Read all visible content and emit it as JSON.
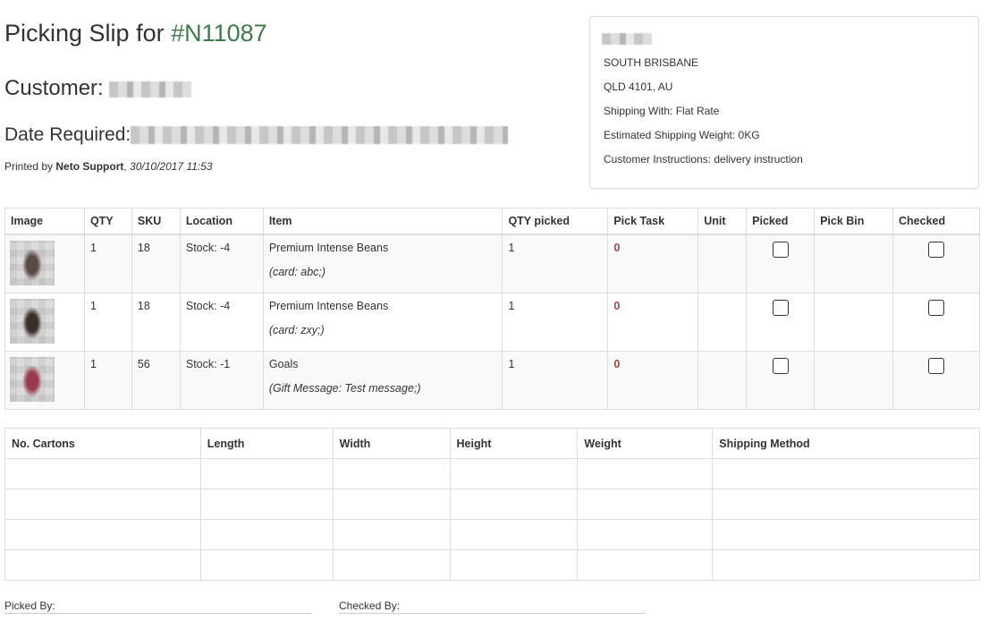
{
  "header": {
    "title_prefix": "Picking Slip for ",
    "order_number": "#N11087",
    "customer_label": "Customer: ",
    "date_label": "Date Required:",
    "printed_by_label": "Printed by ",
    "printed_by_name": "Neto Support",
    "printed_at": "30/10/2017 11:53"
  },
  "address": {
    "lines": [
      "SOUTH BRISBANE",
      "QLD 4101, AU",
      "Shipping With: Flat Rate",
      "Estimated Shipping Weight: 0KG",
      "Customer Instructions: delivery instruction"
    ]
  },
  "items_table": {
    "headers": [
      "Image",
      "QTY",
      "SKU",
      "Location",
      "Item",
      "QTY picked",
      "Pick Task",
      "Unit",
      "Picked",
      "Pick Bin",
      "Checked"
    ],
    "rows": [
      {
        "qty": "1",
        "sku": "18",
        "location": "Stock: -4",
        "item": "Premium Intense Beans",
        "options": "(card: abc;)",
        "qty_picked": "1",
        "pick_task": "0",
        "unit": "",
        "pick_bin": "",
        "thumb_color": "#5a4a44"
      },
      {
        "qty": "1",
        "sku": "18",
        "location": "Stock: -4",
        "item": "Premium Intense Beans",
        "options": "(card: zxy;)",
        "qty_picked": "1",
        "pick_task": "0",
        "unit": "",
        "pick_bin": "",
        "thumb_color": "#3b2f2a"
      },
      {
        "qty": "1",
        "sku": "56",
        "location": "Stock: -1",
        "item": "Goals",
        "options": "(Gift Message: Test message;)",
        "qty_picked": "1",
        "pick_task": "0",
        "unit": "",
        "pick_bin": "",
        "thumb_color": "#9a3b4c"
      }
    ]
  },
  "cartons_table": {
    "headers": [
      "No. Cartons",
      "Length",
      "Width",
      "Height",
      "Weight",
      "Shipping Method"
    ]
  },
  "signoff": {
    "picked_by_label": "Picked By:",
    "checked_by_label": "Checked By:"
  }
}
